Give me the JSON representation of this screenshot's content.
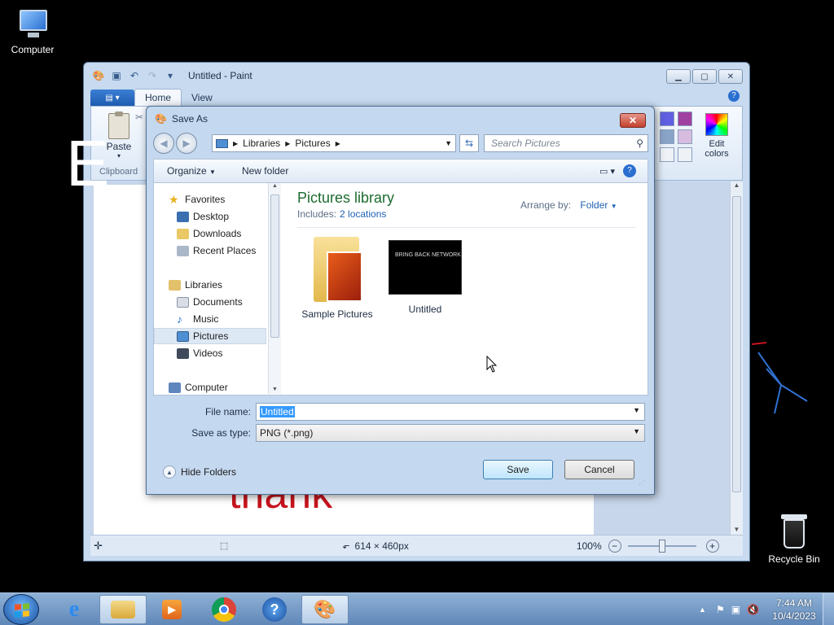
{
  "desktop": {
    "icons": [
      {
        "label": "Computer"
      },
      {
        "label": "Recycle Bin"
      }
    ]
  },
  "paint": {
    "title": "Untitled - Paint",
    "tabs": [
      "Home",
      "View"
    ],
    "ribbon": {
      "paste_label": "Paste",
      "clipboard_group": "Clipboard",
      "edit_colors_label": "Edit colors",
      "palette": [
        "#6060e0",
        "#a040a0",
        "#8aa4c8",
        "#d8bce0",
        "#eef2f7",
        "#eef2f7"
      ]
    },
    "canvas_text": {
      "top_letter": "E",
      "bottom_text": "thank"
    },
    "status": {
      "dimensions": "614 × 460px",
      "zoom": "100%"
    }
  },
  "dialog": {
    "title": "Save As",
    "breadcrumb": [
      "Libraries",
      "Pictures"
    ],
    "search_placeholder": "Search Pictures",
    "toolbar": {
      "organize": "Organize",
      "new_folder": "New folder"
    },
    "nav_tree": [
      {
        "label": "Favorites",
        "icon": "star-icon"
      },
      {
        "label": "Desktop",
        "icon": "desktop-icon"
      },
      {
        "label": "Downloads",
        "icon": "downloads-icon"
      },
      {
        "label": "Recent Places",
        "icon": "recent-places-icon"
      },
      {
        "label": "Libraries",
        "icon": "libraries-icon"
      },
      {
        "label": "Documents",
        "icon": "documents-icon"
      },
      {
        "label": "Music",
        "icon": "music-icon"
      },
      {
        "label": "Pictures",
        "icon": "pictures-icon"
      },
      {
        "label": "Videos",
        "icon": "videos-icon"
      },
      {
        "label": "Computer",
        "icon": "computer-icon"
      }
    ],
    "library": {
      "title": "Pictures library",
      "includes_label": "Includes:",
      "locations_link": "2 locations",
      "arrange_label": "Arrange by:",
      "arrange_value": "Folder"
    },
    "items": [
      {
        "label": "Sample Pictures"
      },
      {
        "label": "Untitled",
        "thumb_text": "BRING BACK NETWORK"
      }
    ],
    "form": {
      "file_name_label": "File name:",
      "file_name_value": "Untitled",
      "save_type_label": "Save as type:",
      "save_type_value": "PNG (*.png)"
    },
    "hide_folders": "Hide Folders",
    "save_button": "Save",
    "cancel_button": "Cancel"
  },
  "taskbar": {
    "time": "7:44 AM",
    "date": "10/4/2023"
  }
}
